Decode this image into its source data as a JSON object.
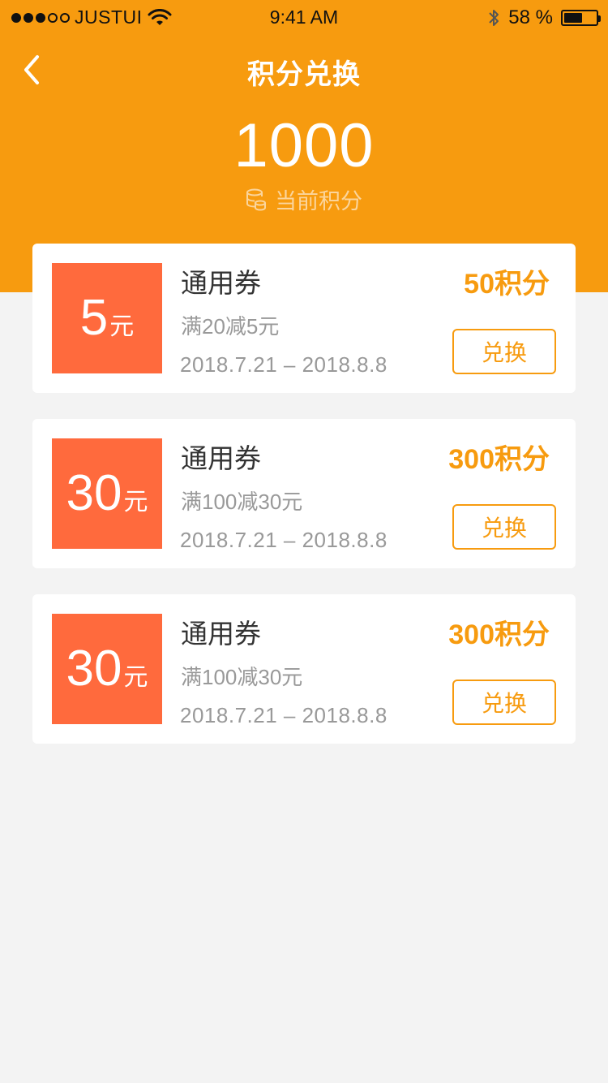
{
  "status_bar": {
    "carrier": "JUSTUI",
    "time": "9:41 AM",
    "battery_text": "58 %",
    "battery_level": 0.58,
    "signal_bars_filled": 3,
    "signal_bars_total": 5,
    "icons": [
      "signal-dots",
      "wifi-icon",
      "bluetooth-icon",
      "battery-icon"
    ]
  },
  "header": {
    "title": "积分兑换",
    "back_icon": "chevron-left-icon",
    "points_value": "1000",
    "points_caption": "当前积分",
    "points_icon": "coins-icon"
  },
  "coupons": [
    {
      "face_amount": "5",
      "face_unit": "元",
      "name": "通用券",
      "rule": "满20减5元",
      "validity": "2018.7.21 – 2018.8.8",
      "cost": "50积分",
      "button_label": "兑换"
    },
    {
      "face_amount": "30",
      "face_unit": "元",
      "name": "通用券",
      "rule": "满100减30元",
      "validity": "2018.7.21 – 2018.8.8",
      "cost": "300积分",
      "button_label": "兑换"
    },
    {
      "face_amount": "30",
      "face_unit": "元",
      "name": "通用券",
      "rule": "满100减30元",
      "validity": "2018.7.21 – 2018.8.8",
      "cost": "300积分",
      "button_label": "兑换"
    }
  ],
  "colors": {
    "brand_orange": "#f79b0f",
    "coupon_face": "#ff6a3d",
    "page_background": "#f3f3f3",
    "caption_light": "#fbd59c"
  }
}
